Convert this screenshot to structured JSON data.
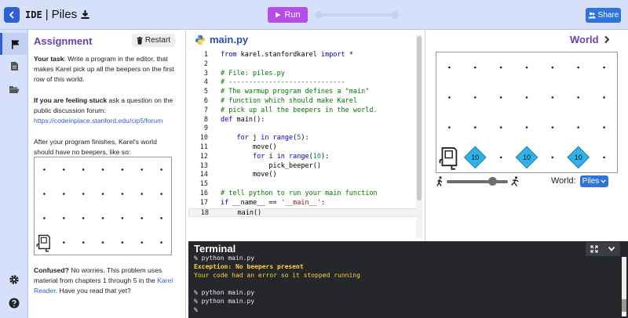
{
  "header": {
    "ide_label": "IDE",
    "separator": "|",
    "project_title": "Piles",
    "run_label": "Run",
    "share_label": "Share",
    "colors": {
      "bar": "#d6e0fa",
      "run": "#b64de8",
      "share": "#2f74dd",
      "back": "#2f5fd8"
    }
  },
  "sidebar": {
    "items": [
      {
        "icon": "flag-icon",
        "active": true
      },
      {
        "icon": "file-icon",
        "active": false
      },
      {
        "icon": "folder-open-icon",
        "active": false
      },
      {
        "icon": "gear-icon",
        "active": false
      },
      {
        "icon": "help-icon",
        "active": false
      }
    ]
  },
  "assignment": {
    "title": "Assignment",
    "restart_label": "Restart",
    "task_strong": "Your task",
    "task_text": ": Write a program in the editor, that makes Karel pick up all the beepers on the first row of this world.",
    "stuck_strong": "If you are feeling stuck",
    "stuck_text": " ask a question on the public discussion forum:",
    "forum_link": "https://codeinplace.stanford.edu/cip5/forum",
    "after_text": "After your program finishes, Karel's world should have no beepers, like so:",
    "confused_strong": "Confused?",
    "confused_text": " No worries. This problem uses material from chapters 1 through 5 in the ",
    "reader_link": "Karel Reader",
    "confused_end": ". Have you read that yet?"
  },
  "editor": {
    "filename": "main.py",
    "lines": [
      {
        "n": "1",
        "tokens": [
          [
            "kw",
            "from "
          ],
          [
            "tx",
            "karel.stanfordkarel "
          ],
          [
            "kw",
            "import "
          ],
          [
            "tx",
            "*"
          ]
        ]
      },
      {
        "n": "2",
        "tokens": []
      },
      {
        "n": "3",
        "tokens": [
          [
            "cm",
            "# File: piles.py"
          ]
        ]
      },
      {
        "n": "4",
        "tokens": [
          [
            "cm",
            "# -----------------------------"
          ]
        ]
      },
      {
        "n": "5",
        "tokens": [
          [
            "cm",
            "# The warmup program defines a \"main\""
          ]
        ]
      },
      {
        "n": "6",
        "tokens": [
          [
            "cm",
            "# function which should make Karel"
          ]
        ]
      },
      {
        "n": "7",
        "tokens": [
          [
            "cm",
            "# pick up all the beepers in the world."
          ]
        ]
      },
      {
        "n": "8",
        "tokens": [
          [
            "kw",
            "def "
          ],
          [
            "fn",
            "main"
          ],
          [
            "tx",
            "():"
          ]
        ]
      },
      {
        "n": "9",
        "tokens": []
      },
      {
        "n": "10",
        "tokens": [
          [
            "tx",
            "    "
          ],
          [
            "kw",
            "for "
          ],
          [
            "tx",
            "j "
          ],
          [
            "kw",
            "in "
          ],
          [
            "kw",
            "range"
          ],
          [
            "tx",
            "("
          ],
          [
            "nm",
            "5"
          ],
          [
            "tx",
            "):"
          ]
        ]
      },
      {
        "n": "11",
        "tokens": [
          [
            "tx",
            "        move()"
          ]
        ]
      },
      {
        "n": "12",
        "tokens": [
          [
            "tx",
            "        "
          ],
          [
            "kw",
            "for "
          ],
          [
            "tx",
            "i "
          ],
          [
            "kw",
            "in "
          ],
          [
            "kw",
            "range"
          ],
          [
            "tx",
            "("
          ],
          [
            "nm",
            "10"
          ],
          [
            "tx",
            "):"
          ]
        ]
      },
      {
        "n": "13",
        "tokens": [
          [
            "tx",
            "            pick_beeper()"
          ]
        ]
      },
      {
        "n": "14",
        "tokens": [
          [
            "tx",
            "        move()"
          ]
        ]
      },
      {
        "n": "15",
        "tokens": []
      },
      {
        "n": "16",
        "tokens": [
          [
            "cm",
            "# tell python to run your main function"
          ]
        ]
      },
      {
        "n": "17",
        "tokens": [
          [
            "kw",
            "if "
          ],
          [
            "tx",
            "__name__ == "
          ],
          [
            "st",
            "'__main__'"
          ],
          [
            "tx",
            ":"
          ]
        ]
      },
      {
        "n": "18",
        "tokens": [
          [
            "tx",
            "    main()"
          ]
        ],
        "current": true
      }
    ]
  },
  "world": {
    "title": "World",
    "world_label": "World:",
    "selected_world": "Piles",
    "beeper_value": "10",
    "beeper_color": "#2fb2e8",
    "speed_fraction": 0.75
  },
  "assignment_world": {
    "note": ""
  },
  "terminal": {
    "title": "Terminal",
    "lines": [
      {
        "kind": "normal",
        "text": "% python main.py"
      },
      {
        "kind": "err",
        "text": "Exception: No beepers present"
      },
      {
        "kind": "warn",
        "text": "Your code had an error so it stopped running"
      },
      {
        "kind": "normal",
        "text": ""
      },
      {
        "kind": "normal",
        "text": "% python main.py"
      },
      {
        "kind": "normal",
        "text": "% python main.py"
      },
      {
        "kind": "normal",
        "text": "%"
      }
    ]
  }
}
